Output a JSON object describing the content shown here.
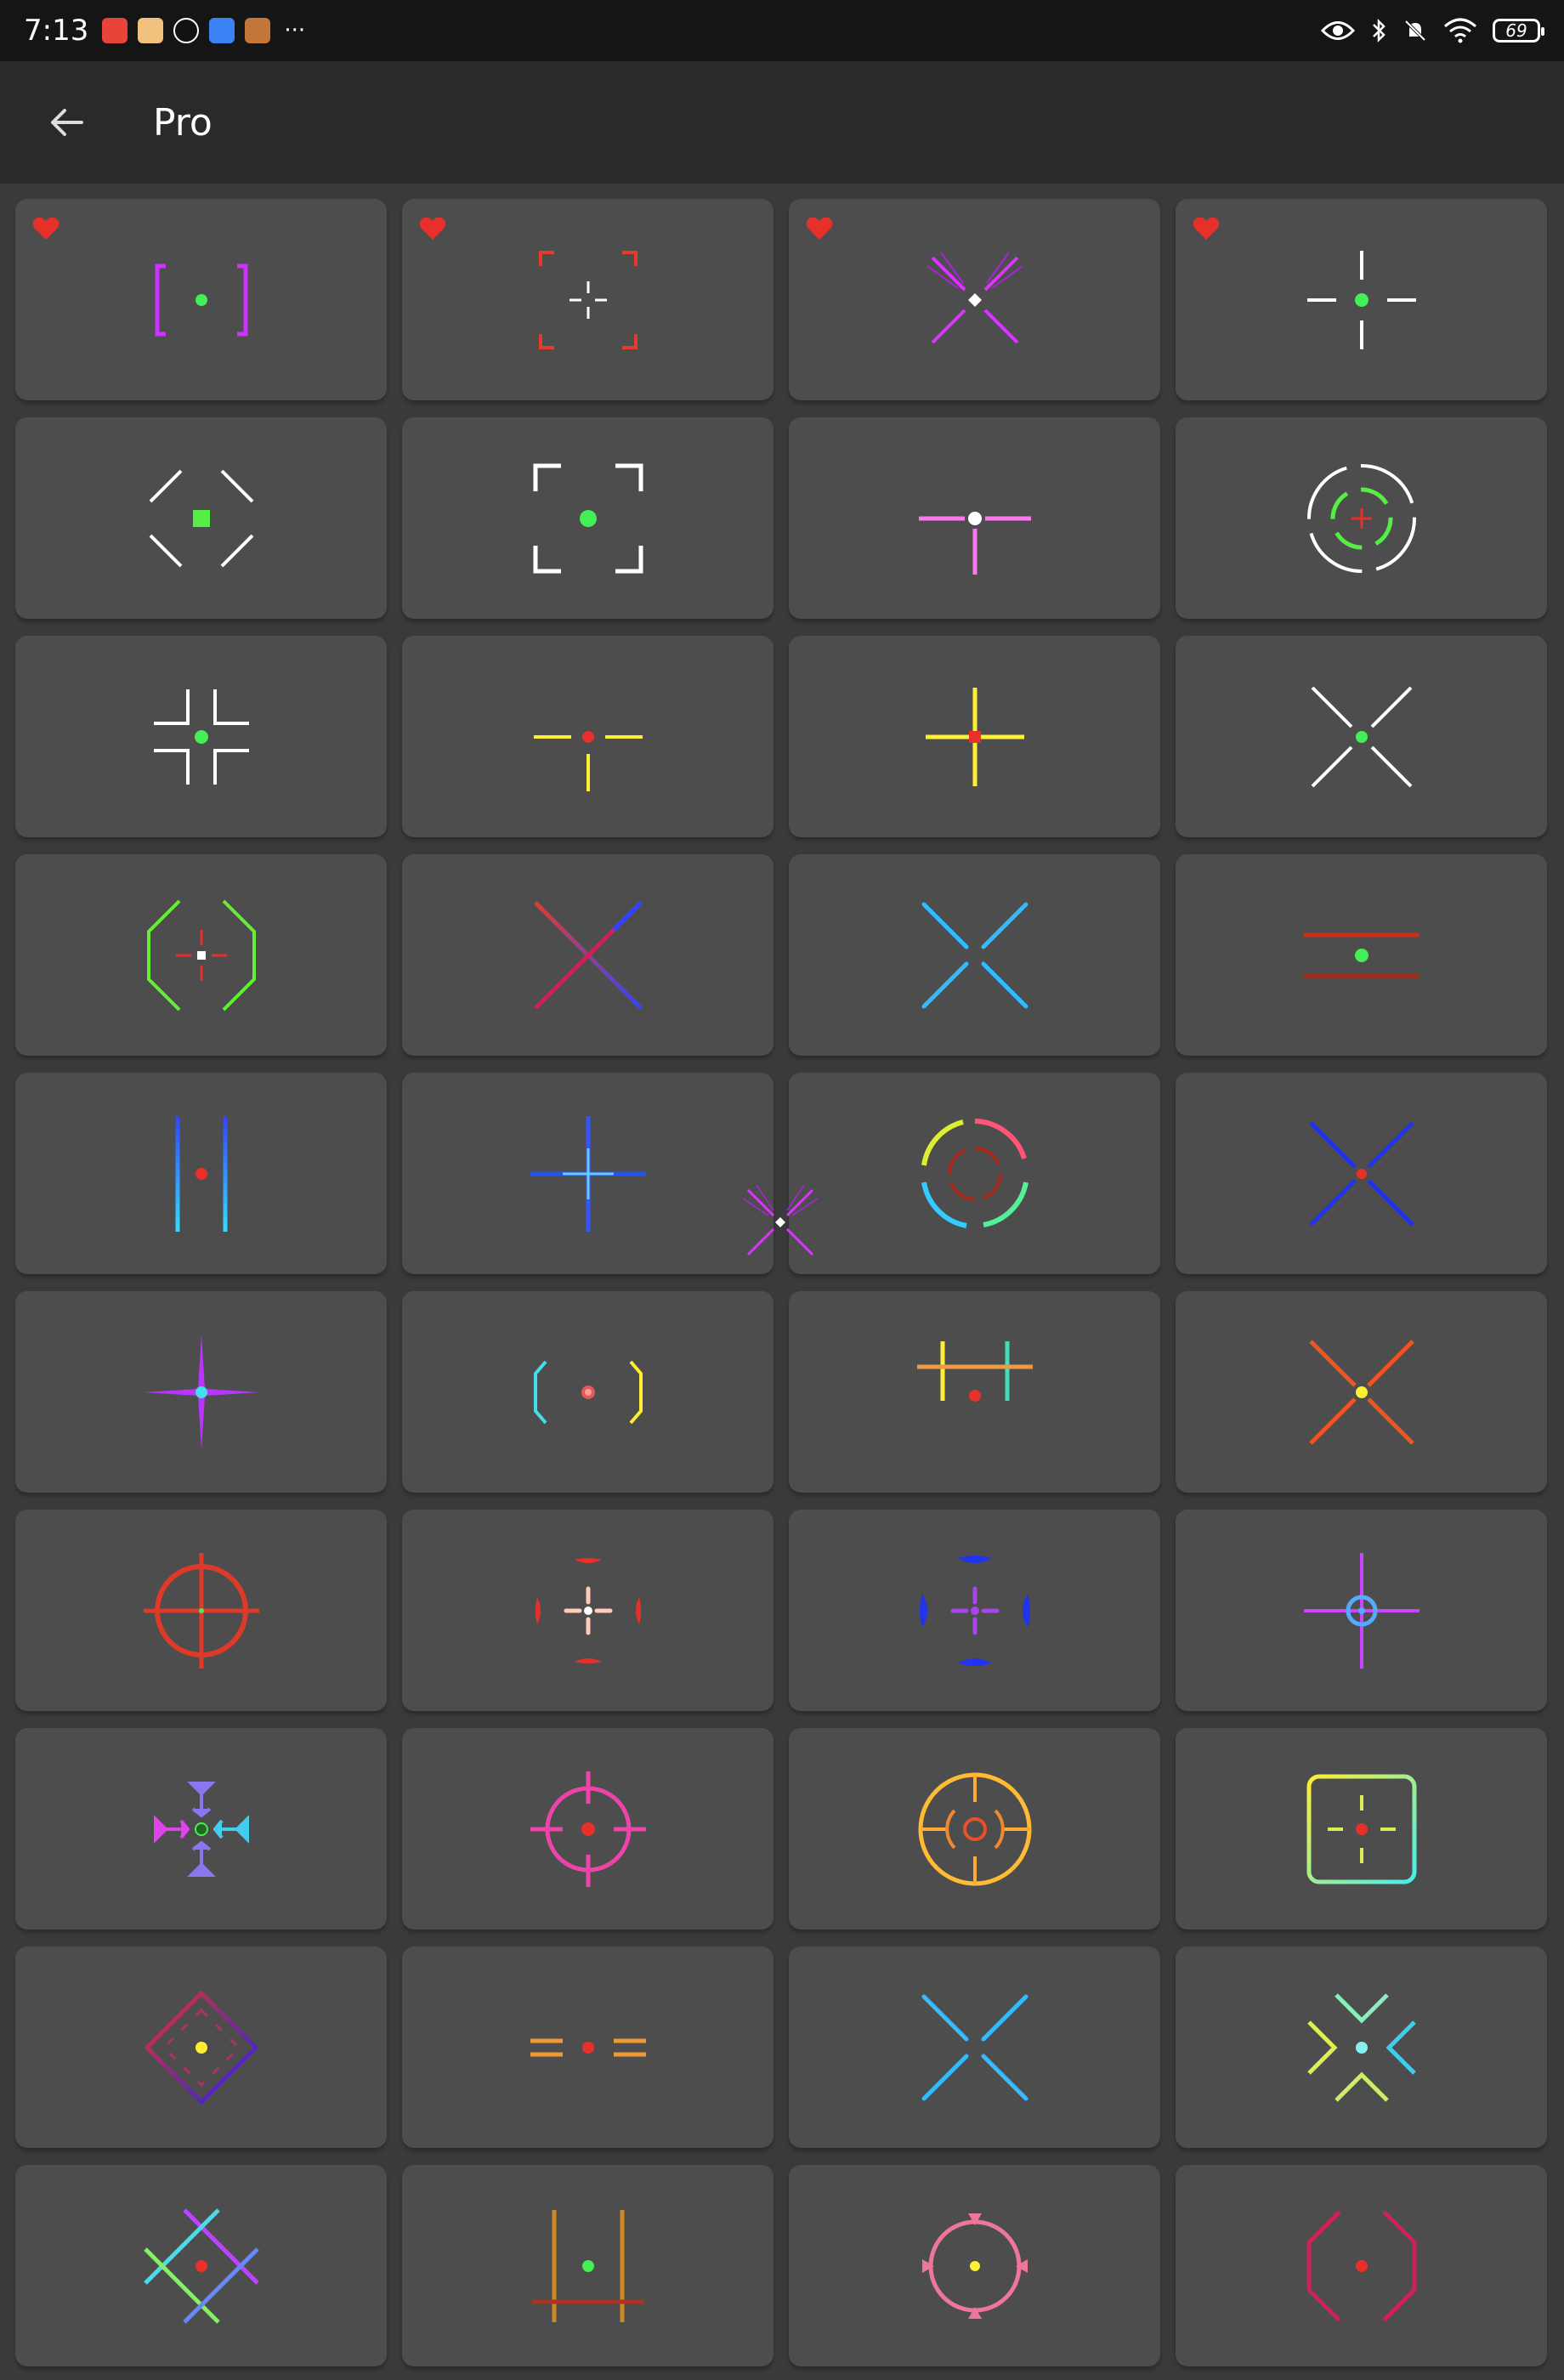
{
  "status_bar": {
    "time": "7:13",
    "notification_icons": [
      "app-notification-icon-1",
      "app-notification-icon-2",
      "tiktok-icon",
      "calendar-icon",
      "game-icon"
    ],
    "more": "···",
    "battery": "69",
    "indicator_icons": [
      "eye-icon",
      "bluetooth-icon",
      "mute-icon",
      "wifi-icon",
      "battery-icon"
    ]
  },
  "app_bar": {
    "title": "Pro",
    "back_icon": "arrow-back-icon"
  },
  "crosshairs": [
    {
      "name": "crosshair-1",
      "style": "magenta-brackets-green-dot",
      "favorite": true
    },
    {
      "name": "crosshair-2",
      "style": "red-corners-white-cross",
      "favorite": true
    },
    {
      "name": "crosshair-3",
      "style": "magenta-x-white-diamond",
      "favorite": true
    },
    {
      "name": "crosshair-4",
      "style": "white-cross-green-dot",
      "favorite": true
    },
    {
      "name": "crosshair-5",
      "style": "white-diagonals-green-square",
      "favorite": false
    },
    {
      "name": "crosshair-6",
      "style": "white-corners-green-dot",
      "favorite": false
    },
    {
      "name": "crosshair-7",
      "style": "pink-t-white-dot",
      "favorite": false
    },
    {
      "name": "crosshair-8",
      "style": "white-green-circles-red-cross",
      "favorite": false
    },
    {
      "name": "crosshair-9",
      "style": "white-inner-corners-green-dot",
      "favorite": false
    },
    {
      "name": "crosshair-10",
      "style": "yellow-t-red-dot",
      "favorite": false
    },
    {
      "name": "crosshair-11",
      "style": "yellow-cross-red-dot",
      "favorite": false
    },
    {
      "name": "crosshair-12",
      "style": "white-x-green-dot",
      "favorite": false
    },
    {
      "name": "crosshair-13",
      "style": "green-octagon-red-cross",
      "favorite": false
    },
    {
      "name": "crosshair-14",
      "style": "blue-red-x",
      "favorite": false
    },
    {
      "name": "crosshair-15",
      "style": "cyan-x",
      "favorite": false
    },
    {
      "name": "crosshair-16",
      "style": "red-lines-green-dot",
      "favorite": false
    },
    {
      "name": "crosshair-17",
      "style": "blue-cyan-bars-red-dot",
      "favorite": false
    },
    {
      "name": "crosshair-18",
      "style": "blue-cross",
      "favorite": false
    },
    {
      "name": "crosshair-19",
      "style": "rainbow-circle",
      "favorite": false
    },
    {
      "name": "crosshair-20",
      "style": "blue-x-red-dot",
      "favorite": false
    },
    {
      "name": "crosshair-21",
      "style": "purple-star-cyan-dot",
      "favorite": false
    },
    {
      "name": "crosshair-22",
      "style": "cyan-yellow-brackets",
      "favorite": false
    },
    {
      "name": "crosshair-23",
      "style": "rainbow-h-red-dot",
      "favorite": false
    },
    {
      "name": "crosshair-24",
      "style": "orange-x-yellow-dot",
      "favorite": false
    },
    {
      "name": "crosshair-25",
      "style": "red-scope",
      "favorite": false
    },
    {
      "name": "crosshair-26",
      "style": "red-pink-arrows",
      "favorite": false
    },
    {
      "name": "crosshair-27",
      "style": "blue-purple-arrows",
      "favorite": false
    },
    {
      "name": "crosshair-28",
      "style": "purple-cross-blue-ring",
      "favorite": false
    },
    {
      "name": "crosshair-29",
      "style": "purple-cyan-arrows",
      "favorite": false
    },
    {
      "name": "crosshair-30",
      "style": "pink-scope-red-dot",
      "favorite": false
    },
    {
      "name": "crosshair-31",
      "style": "yellow-orange-scope",
      "favorite": false
    },
    {
      "name": "crosshair-32",
      "style": "yellow-cyan-square",
      "favorite": false
    },
    {
      "name": "crosshair-33",
      "style": "red-blue-diamond",
      "favorite": false
    },
    {
      "name": "crosshair-34",
      "style": "orange-dashes-red-dot",
      "favorite": false
    },
    {
      "name": "crosshair-35",
      "style": "cyan-x",
      "favorite": false
    },
    {
      "name": "crosshair-36",
      "style": "green-cyan-chevrons",
      "favorite": false
    },
    {
      "name": "crosshair-37",
      "style": "rainbow-lattice",
      "favorite": false
    },
    {
      "name": "crosshair-38",
      "style": "orange-h-green-dot",
      "favorite": false
    },
    {
      "name": "crosshair-39",
      "style": "pink-circle-yellow-dot",
      "favorite": false
    },
    {
      "name": "crosshair-40",
      "style": "crimson-octagon",
      "favorite": false
    }
  ],
  "colors": {
    "background": "#3a3a3a",
    "card": "#4d4d4d",
    "app_bar": "#2a2a2a",
    "status_bar": "#151515",
    "favorite": "#e8302a"
  }
}
